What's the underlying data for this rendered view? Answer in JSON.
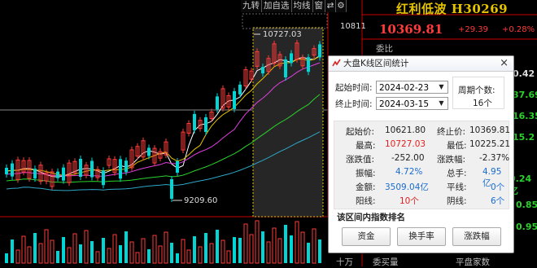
{
  "toolbar": {
    "nine_turns": "九转",
    "add_watch": "加自选",
    "ma": "均线",
    "window": "窗",
    "icons": [
      "swap-icon",
      "settings-icon"
    ]
  },
  "index": {
    "name": "红利低波 H30269",
    "value": "10369.81",
    "change": "+29.39",
    "change_pct": "+0.28%"
  },
  "right_panel": {
    "wei_bi_label": "委比",
    "value_1": "0.42",
    "value_2": "37.69",
    "value_3": "16.35",
    "value_4": "15.2",
    "value_5": "0.85",
    "value_6": "0.95",
    "value_7": "0.24亿",
    "scale_label": "十万",
    "bottom_a": "委买量",
    "bottom_b": "平盘家数"
  },
  "price_axis": {
    "top_price": "10811",
    "high_label": "10727.03",
    "low_label": "9209.60"
  },
  "dialog": {
    "title": "大盘K线区间统计",
    "start_label": "起始时间:",
    "start_value": "2024-02-23",
    "end_label": "终止时间:",
    "end_value": "2024-03-15",
    "period_title": "周期个数:",
    "period_value": "16个",
    "stats": [
      {
        "label": "起始价:",
        "value": "10621.80",
        "label2": "终止价:",
        "value2": "10369.81"
      },
      {
        "label": "最高:",
        "value": "10727.03",
        "label2": "最低:",
        "value2": "10225.21"
      },
      {
        "label": "涨跌值:",
        "value": "-252.00",
        "label2": "涨跌幅:",
        "value2": "-2.37%"
      },
      {
        "label": "振幅:",
        "value": "4.72%",
        "label2": "总手:",
        "value2": "4.95亿"
      },
      {
        "label": "金额:",
        "value": "3509.04亿",
        "label2": "平线:",
        "value2": "0个"
      },
      {
        "label": "阳线:",
        "value": "10个",
        "label2": "阴线:",
        "value2": "6个"
      }
    ],
    "section_title": "该区间内指数排名",
    "buttons": [
      "资金",
      "换手率",
      "涨跌幅"
    ]
  },
  "colors": {
    "up": "#ff3b3b",
    "down": "#00d6d6",
    "ma5": "#ffffff",
    "ma10": "#e6c400",
    "ma20": "#e040e0",
    "ma60": "#2bd22b",
    "ma120": "#2ea6c8"
  }
}
